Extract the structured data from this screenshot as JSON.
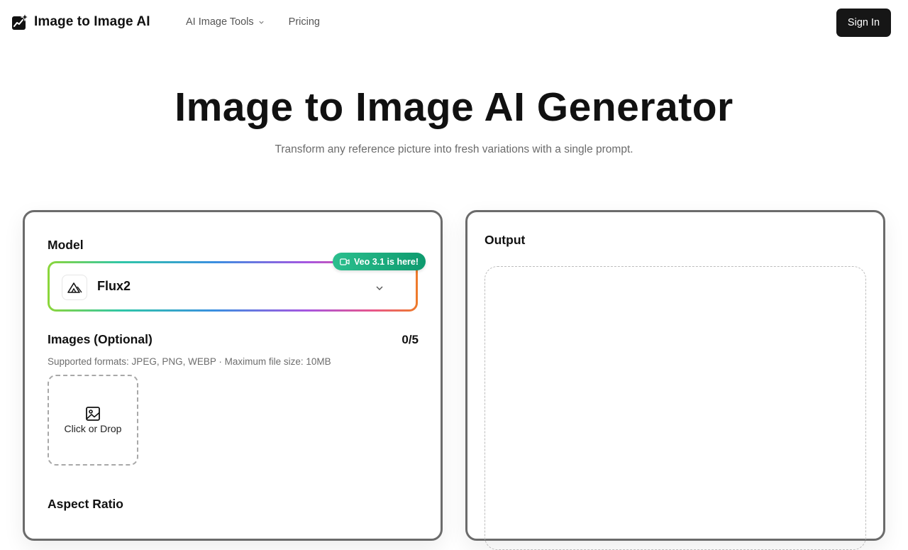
{
  "header": {
    "brand": "Image to Image AI",
    "nav": [
      {
        "label": "AI Image Tools"
      },
      {
        "label": "Pricing"
      }
    ],
    "sign_in": "Sign In"
  },
  "hero": {
    "title": "Image to Image AI Generator",
    "subtitle": "Transform any reference picture into fresh variations with a single prompt."
  },
  "form": {
    "model_label": "Model",
    "model_value": "Flux2",
    "badge": "Veo 3.1 is here!",
    "images_label": "Images (Optional)",
    "images_count": "0/5",
    "formats": "Supported formats: JPEG, PNG, WEBP · Maximum file size: 10MB",
    "upload_label": "Click or Drop",
    "aspect_label": "Aspect Ratio"
  },
  "output": {
    "label": "Output"
  },
  "colors": {
    "primary_button": "#161616",
    "badge_green": "#16a37a",
    "panel_border": "#6b6b6b"
  }
}
